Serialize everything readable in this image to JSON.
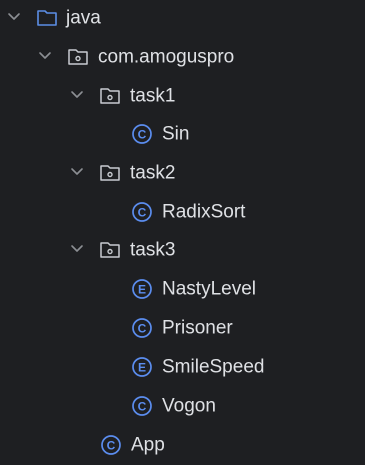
{
  "colors": {
    "background": "#1e1f22",
    "text": "#dfe1e5",
    "chevron": "#8c8f94",
    "folder_outline": "#c9ccd1",
    "source_root_folder": "#5c8ee6",
    "class_icon": "#5b8def",
    "enum_icon": "#5b8def"
  },
  "tree": {
    "java": {
      "label": "java",
      "icon": "source-folder-icon"
    },
    "package": {
      "label": "com.amoguspro",
      "icon": "package-icon"
    },
    "task1": {
      "label": "task1",
      "icon": "package-icon"
    },
    "sin": {
      "label": "Sin",
      "icon": "class-icon",
      "badge": "C"
    },
    "task2": {
      "label": "task2",
      "icon": "package-icon"
    },
    "radixsort": {
      "label": "RadixSort",
      "icon": "class-icon",
      "badge": "C"
    },
    "task3": {
      "label": "task3",
      "icon": "package-icon"
    },
    "nastylevel": {
      "label": "NastyLevel",
      "icon": "enum-icon",
      "badge": "E"
    },
    "prisoner": {
      "label": "Prisoner",
      "icon": "class-icon",
      "badge": "C"
    },
    "smilespeed": {
      "label": "SmileSpeed",
      "icon": "enum-icon",
      "badge": "E"
    },
    "vogon": {
      "label": "Vogon",
      "icon": "class-icon",
      "badge": "C"
    },
    "app": {
      "label": "App",
      "icon": "class-icon",
      "badge": "C"
    }
  }
}
